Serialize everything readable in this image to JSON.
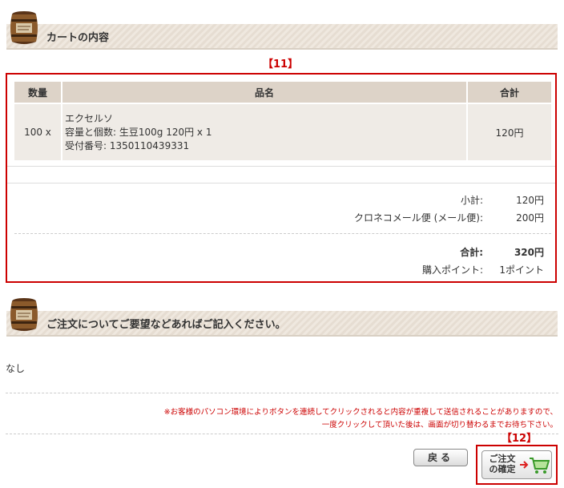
{
  "cart_section": {
    "title": "カートの内容",
    "annotation": "【11】"
  },
  "table": {
    "headers": {
      "qty": "数量",
      "item": "品名",
      "total": "合計"
    },
    "row": {
      "qty": "100 x",
      "name": "エクセルソ",
      "option": "容量と個数: 生豆100g  120円 x 1",
      "order_no": "受付番号: 1350110439331",
      "price": "120円"
    }
  },
  "summary": {
    "subtotal_label": "小計:",
    "subtotal_value": "120円",
    "shipping_label": "クロネコメール便 (メール便):",
    "shipping_value": "200円",
    "total_label": "合計:",
    "total_value": "320円",
    "points_label": "購入ポイント:",
    "points_value": "1ポイント"
  },
  "request_section": {
    "title": "ご注文についてご要望などあればご記入ください。",
    "note": "なし"
  },
  "notice": {
    "line1": "※お客様のパソコン環境によりボタンを連続してクリックされると内容が重複して送信されることがありますので、",
    "line2": "一度クリックして頂いた後は、画面が切り替わるまでお待ち下さい。"
  },
  "buttons": {
    "back_label": "戻る",
    "confirm_line1": "ご注文",
    "confirm_line2": "の確定",
    "confirm_annotation": "【12】"
  },
  "colors": {
    "accent_red": "#cc0000",
    "header_bg": "#ddd3c8",
    "cell_bg": "#efebe6"
  }
}
